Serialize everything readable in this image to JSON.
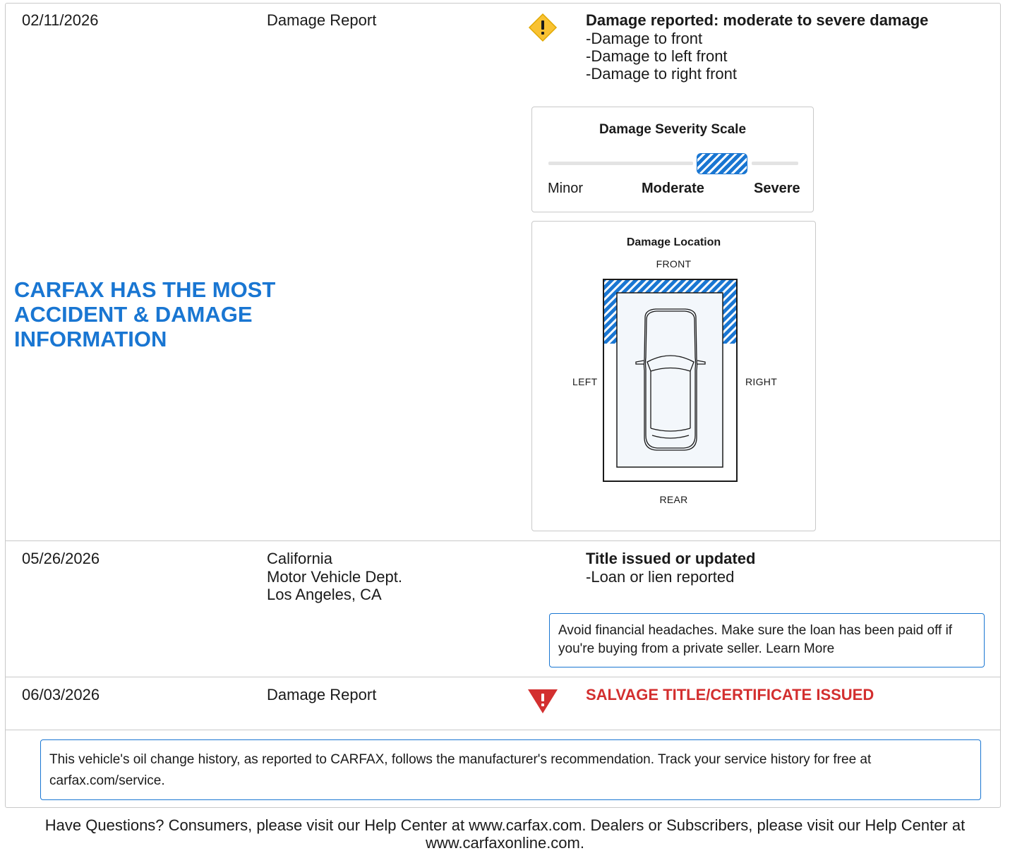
{
  "records": [
    {
      "date": "02/11/2026",
      "source": "Damage Report",
      "headline": "Damage reported: moderate to severe damage",
      "details": [
        "Damage to front",
        "Damage to left front",
        "Damage to right front"
      ],
      "icon": "warning-diamond-icon"
    },
    {
      "date": "05/26/2026",
      "source_lines": [
        "California",
        "Motor Vehicle Dept.",
        "Los Angeles, CA"
      ],
      "headline": "Title issued or updated",
      "details": [
        "Loan or lien reported"
      ],
      "tip": "Avoid financial headaches. Make sure the loan has been paid off if you're buying from a private seller.",
      "tip_link": "Learn More"
    },
    {
      "date": "06/03/2026",
      "source": "Damage Report",
      "headline": "SALVAGE TITLE/CERTIFICATE ISSUED",
      "icon": "alert-triangle-icon"
    }
  ],
  "promo": "CARFAX HAS THE MOST ACCIDENT & DAMAGE INFORMATION",
  "severity": {
    "title": "Damage Severity Scale",
    "labels": [
      "Minor",
      "Moderate",
      "Severe"
    ],
    "level": "Moderate"
  },
  "location": {
    "title": "Damage Location",
    "front": "FRONT",
    "rear": "REAR",
    "left": "LEFT",
    "right": "RIGHT",
    "damaged_areas": [
      "front",
      "left front",
      "right front"
    ]
  },
  "oil_notice": "This vehicle's oil change history, as reported to CARFAX, follows the manufacturer's recommendation. Track your service history for free at carfax.com/service.",
  "footer": "Have Questions? Consumers, please visit our Help Center at www.carfax.com. Dealers or Subscribers, please visit our Help Center at www.carfaxonline.com.",
  "colors": {
    "accent_blue": "#1976d2",
    "warning_yellow": "#f9c232",
    "alert_red": "#d32f2f"
  }
}
